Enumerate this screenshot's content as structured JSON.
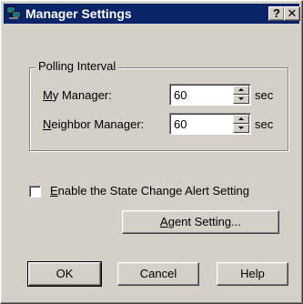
{
  "window": {
    "title": "Manager Settings",
    "help_button": "?",
    "close_button": "✕"
  },
  "polling": {
    "group_label": "Polling Interval",
    "my_manager": {
      "label_access": "M",
      "label_rest": "y Manager:",
      "value": "60",
      "unit": "sec"
    },
    "neighbor_manager": {
      "label_access": "N",
      "label_rest": "eighbor Manager:",
      "value": "60",
      "unit": "sec"
    }
  },
  "alert": {
    "checkbox_access": "E",
    "checkbox_rest": "nable the State Change Alert Setting",
    "checked": false
  },
  "buttons": {
    "agent_setting_access": "A",
    "agent_setting_rest": "gent Setting...",
    "ok": "OK",
    "cancel": "Cancel",
    "help": "Help"
  }
}
